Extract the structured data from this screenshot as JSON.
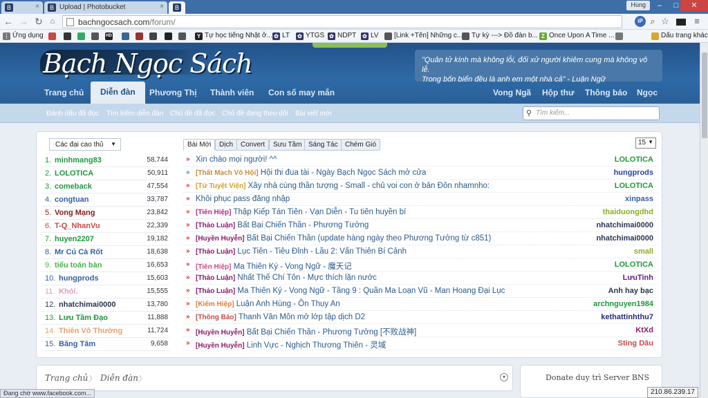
{
  "browser": {
    "tabs": [
      {
        "label": ""
      },
      {
        "label": "Upload | Photobucket"
      },
      {
        "label": ""
      }
    ],
    "user_badge": "Hùng",
    "url_host": "bachngocsach.com",
    "url_path": "/forum/",
    "bookmarks": [
      {
        "label": "Ứng dụng",
        "color": "#777"
      },
      {
        "label": "",
        "color": "#c44"
      },
      {
        "label": "",
        "color": "#333"
      },
      {
        "label": "",
        "color": "#3a6"
      },
      {
        "label": "",
        "color": "#555"
      },
      {
        "label": "",
        "color": "#222"
      },
      {
        "label": "",
        "color": "#369"
      },
      {
        "label": "",
        "color": "#933"
      },
      {
        "label": "",
        "color": "#444"
      },
      {
        "label": "Tự học tiếng Nhật ở...",
        "color": "#222"
      },
      {
        "label": "LT",
        "color": "#336"
      },
      {
        "label": "YTGS",
        "color": "#336"
      },
      {
        "label": "NDPT",
        "color": "#336"
      },
      {
        "label": "LV",
        "color": "#336"
      },
      {
        "label": "[Link +Tên] Những c...",
        "color": "#555"
      },
      {
        "label": "Tự kỳ ---> Đồ đàn b...",
        "color": "#555"
      },
      {
        "label": "Once Upon A Time ...",
        "color": "#6a3"
      },
      {
        "label": "",
        "color": "#777"
      },
      {
        "label": "Dấu trang khác",
        "color": "#d9a72b"
      }
    ]
  },
  "site": {
    "logo_text": "Bạch Ngọc Sách",
    "quote_line1": "\"Quân tử kính mà không lỗi, đối xử người khiêm cung mà không vô lễ.",
    "quote_line2": "Trong bốn biển đều là anh em một nhà cả\" - Luận Ngữ",
    "nav_left": [
      "Trang chủ",
      "Diễn đàn",
      "Phương Thị",
      "Thành viên",
      "Con số may mắn"
    ],
    "nav_right": [
      "Vong Ngã",
      "Hộp thư",
      "Thông báo",
      "Ngọc"
    ],
    "subnav": [
      "Đánh dấu đã đọc",
      "Tìm kiếm diễn đàn",
      "Chủ đề đã đọc",
      "Chủ đề đang theo dõi",
      "Bài viết mới"
    ],
    "search_placeholder": "Tìm kiếm..."
  },
  "top_members": {
    "dropdown_label": "Các đại cao thủ",
    "rows": [
      {
        "rank": "1.",
        "name": "minhmang83",
        "score": "58,744",
        "color": "#1a9a3a"
      },
      {
        "rank": "2.",
        "name": "LOLOTICA",
        "score": "50,911",
        "color": "#1a9a3a"
      },
      {
        "rank": "3.",
        "name": "comeback",
        "score": "47,554",
        "color": "#1a9a3a"
      },
      {
        "rank": "4.",
        "name": "congtuan",
        "score": "33,787",
        "color": "#3560a0"
      },
      {
        "rank": "5.",
        "name": "Vong Mạng",
        "score": "23,842",
        "color": "#8a1a1a"
      },
      {
        "rank": "6.",
        "name": "T-Q_NhanVu",
        "score": "22,339",
        "color": "#c84a4a"
      },
      {
        "rank": "7.",
        "name": "huyen2207",
        "score": "19,182",
        "color": "#1a9a3a"
      },
      {
        "rank": "8.",
        "name": "Mr Củ Cà Rốt",
        "score": "18,638",
        "color": "#3560a0"
      },
      {
        "rank": "9.",
        "name": "tiểu toán bàn",
        "score": "16,653",
        "color": "#4ab04a"
      },
      {
        "rank": "10.",
        "name": "hungprods",
        "score": "15,603",
        "color": "#3560a0"
      },
      {
        "rank": "11.",
        "name": "Khói.",
        "score": "15,555",
        "color": "#d9a0b0"
      },
      {
        "rank": "12.",
        "name": "nhatchimai0000",
        "score": "13,780",
        "color": "#2a3550"
      },
      {
        "rank": "13.",
        "name": "Lưu Tầm Đạo",
        "score": "11,888",
        "color": "#1a9a3a"
      },
      {
        "rank": "14.",
        "name": "Thiên Vô Thường",
        "score": "11,724",
        "color": "#e8a070"
      },
      {
        "rank": "15.",
        "name": "Băng Tâm",
        "score": "9,658",
        "color": "#3560a0"
      }
    ]
  },
  "threads": {
    "tabs": [
      "Bài Mới",
      "Dịch",
      "Convert",
      "Sưu Tầm",
      "Sáng Tác",
      "Chém Gió"
    ],
    "page_value": "15",
    "rows": [
      {
        "tag": "",
        "tag_color": "#c33",
        "title": "Xin chào mọi người! ^^",
        "author": "LOLOTICA",
        "author_color": "#1a9a3a",
        "marker_color": "#c33"
      },
      {
        "tag": "[Thất Mạch Vô Hội]",
        "tag_color": "#c98a3a",
        "title": "Hội thi đua tài - Ngày Bạch Ngọc Sách mở cửa",
        "author": "hungprods",
        "author_color": "#2a3fb0",
        "marker_color": "#3a8ad0"
      },
      {
        "tag": "[Tử Tuyệt Viện]",
        "tag_color": "#d4a020",
        "title": "Xây nhà cùng thần tượng - Small - chủ voi con ở bản Đôn nhamnho:",
        "author": "LOLOTICA",
        "author_color": "#1a9a3a",
        "marker_color": "#c33"
      },
      {
        "tag": "",
        "tag_color": "#c33",
        "title": "Khôi phục pass đăng nhập",
        "author": "xinpass",
        "author_color": "#3560a0",
        "marker_color": "#c33"
      },
      {
        "tag": "[Tiên Hiệp]",
        "tag_color": "#b02a8a",
        "title": "Thập Kiếp Tán Tiên - Vạn Diễn - Tu tiên huyền bí",
        "author": "thaiduongdhd",
        "author_color": "#8ab020",
        "marker_color": "#c33"
      },
      {
        "tag": "[Thảo Luận]",
        "tag_color": "#8a1a6a",
        "title": "Bất Bại Chiến Thần - Phương Tưởng",
        "author": "nhatchimai0000",
        "author_color": "#2a3550",
        "marker_color": "#c33"
      },
      {
        "tag": "[Huyền Huyễn]",
        "tag_color": "#8a1a6a",
        "title": "Bất Bại Chiến Thần (update hàng ngày theo Phương Tưởng từ c851)",
        "author": "nhatchimai0000",
        "author_color": "#2a3550",
        "marker_color": "#c33"
      },
      {
        "tag": "[Thảo Luận]",
        "tag_color": "#8a1a6a",
        "title": "Lục Tiên - Tiêu Đỉnh - Lầu 2: Vấn Thiên Bí Cảnh",
        "author": "small",
        "author_color": "#8ab020",
        "marker_color": "#c33"
      },
      {
        "tag": "[Tiên Hiệp]",
        "tag_color": "#c84a8a",
        "title": "Ma Thiên Ký - Vong Ngữ - 魔天记",
        "author": "LOLOTICA",
        "author_color": "#1a9a3a",
        "marker_color": "#c33"
      },
      {
        "tag": "[Thảo Luận]",
        "tag_color": "#8a1a6a",
        "title": "Nhất Thế Chí Tôn - Mực thích lặn nước",
        "author": "LưuTinh",
        "author_color": "#6a1a8a",
        "marker_color": "#c33"
      },
      {
        "tag": "[Thảo Luận]",
        "tag_color": "#8a1a6a",
        "title": "Ma Thiên Ký - Vong Ngữ - Tầng 9 : Quần Ma Loạn Vũ - Man Hoang Đại Lục",
        "author": "Anh hay bạc",
        "author_color": "#2a3550",
        "marker_color": "#c33"
      },
      {
        "tag": "[Kiếm Hiệp]",
        "tag_color": "#e07a3a",
        "title": "Luận Anh Hùng - Ôn Thụy An",
        "author": "archnguyen1984",
        "author_color": "#1a9a3a",
        "marker_color": "#c33"
      },
      {
        "tag": "[Thông Báo]",
        "tag_color": "#c84a4a",
        "title": "Thanh Vân Môn mở lớp tập dịch D2",
        "author": "kethattinhthu7",
        "author_color": "#2a2a80",
        "marker_color": "#c33"
      },
      {
        "tag": "[Huyền Huyễn]",
        "tag_color": "#8a1a6a",
        "title": "Bất Bại Chiến Thần - Phương Tưởng [不败战神]",
        "author": "KtXd",
        "author_color": "#8a1a6a",
        "marker_color": "#c33"
      },
      {
        "tag": "[Huyền Huyễn]",
        "tag_color": "#8a1a6a",
        "title": "Linh Vực - Nghịch Thương Thiên - 灵域",
        "author": "Sting Dâu",
        "author_color": "#c84a4a",
        "marker_color": "#c33"
      }
    ]
  },
  "footer": {
    "breadcrumb": [
      "Trang chủ",
      "Diễn đàn"
    ],
    "donate_title": "Donate duy trì Server BNS",
    "status_left": "Đang chờ www.facebook.com...",
    "status_right": "210.86.239.17"
  }
}
